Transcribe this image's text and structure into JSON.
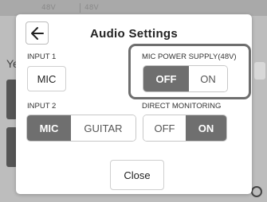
{
  "background": {
    "top_tags": [
      "48V",
      "48V"
    ],
    "side_letter": "Ye"
  },
  "dialog": {
    "title": "Audio Settings",
    "back_icon": "arrow-left-icon",
    "input1": {
      "label": "INPUT 1",
      "value": "MIC"
    },
    "mic_power": {
      "label": "MIC POWER SUPPLY(48V)",
      "options": [
        "OFF",
        "ON"
      ],
      "selected": "OFF"
    },
    "input2": {
      "label": "INPUT 2",
      "options": [
        "MIC",
        "GUITAR"
      ],
      "selected": "MIC"
    },
    "direct_monitoring": {
      "label": "DIRECT MONITORING",
      "options": [
        "OFF",
        "ON"
      ],
      "selected": "ON"
    },
    "close_label": "Close"
  },
  "colors": {
    "selected_segment": "#6f6f6f",
    "highlight_border": "#6e6e6e",
    "overlay": "#b8b8b8"
  }
}
